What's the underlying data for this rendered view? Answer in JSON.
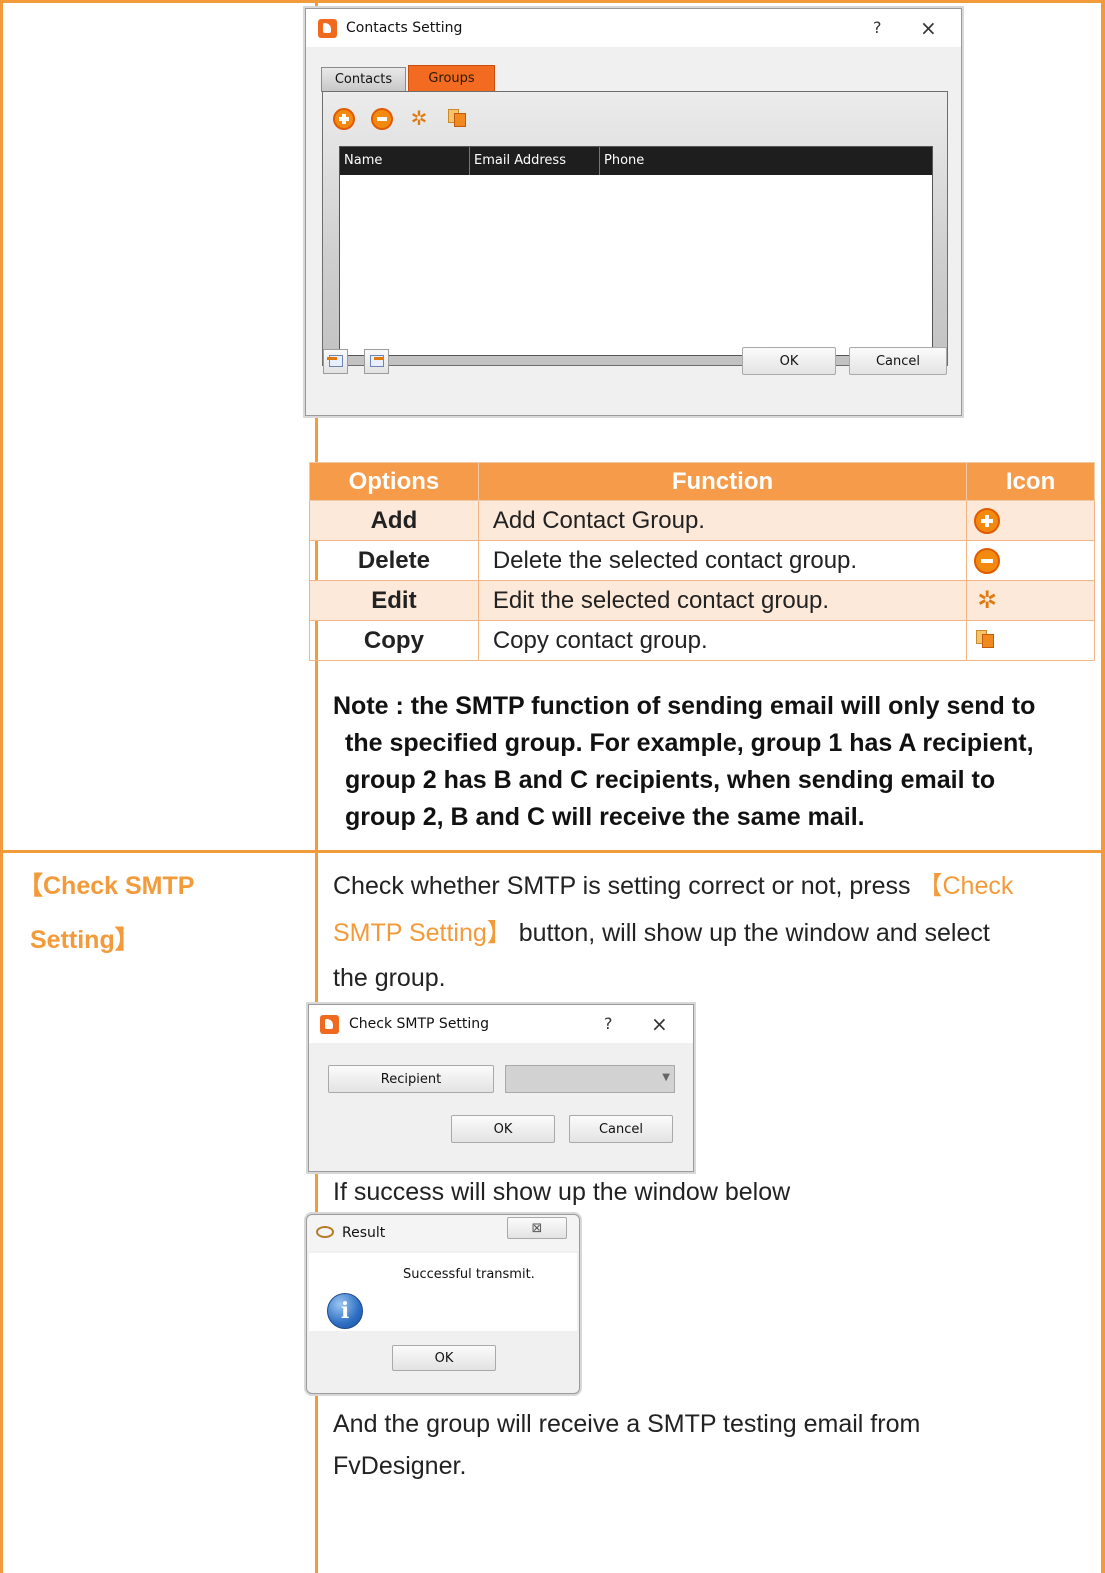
{
  "contacts_dialog": {
    "title": "Contacts Setting",
    "help": "?",
    "close": "×",
    "tabs": [
      "Contacts",
      "Groups"
    ],
    "columns": [
      "Name",
      "Email Address",
      "Phone"
    ],
    "ok": "OK",
    "cancel": "Cancel"
  },
  "options_table": {
    "headers": [
      "Options",
      "Function",
      "Icon"
    ],
    "rows": [
      {
        "option": "Add",
        "function": "Add Contact Group.",
        "icon": "add-icon"
      },
      {
        "option": "Delete",
        "function": "Delete the selected contact group.",
        "icon": "delete-icon"
      },
      {
        "option": "Edit",
        "function": "Edit the selected contact group.",
        "icon": "edit-gear-icon"
      },
      {
        "option": "Copy",
        "function": "Copy contact group.",
        "icon": "copy-icon"
      }
    ]
  },
  "note": {
    "line1": "Note : the SMTP function of sending email will only send to",
    "line2": "the specified group. For example, group 1 has A recipient,",
    "line3": "group 2 has B and C recipients, when sending email to",
    "line4": "group 2, B and C will receive the same mail."
  },
  "check_smtp": {
    "label_line1": "【Check SMTP",
    "label_line2": "Setting】",
    "desc_pre": "Check whether SMTP is setting correct or not, press",
    "desc_hl1": "【Check",
    "desc_hl2": "SMTP Setting】",
    "desc_post": " button, will show up the window and select",
    "desc_line3": "the group.",
    "dialog": {
      "title": "Check SMTP Setting",
      "help": "?",
      "close": "×",
      "recipient": "Recipient",
      "ok": "OK",
      "cancel": "Cancel"
    },
    "success_text": "If success will show up the window below",
    "result_dialog": {
      "title": "Result",
      "close": "⊠",
      "message": "Successful transmit.",
      "ok": "OK"
    },
    "final_line1": "And the group will receive a SMTP testing email from",
    "final_line2": "FvDesigner."
  },
  "colors": {
    "accent": "#f39a3a",
    "tab_active": "#f26b21",
    "table_header": "#f59b49",
    "table_alt": "#fde9d9"
  }
}
